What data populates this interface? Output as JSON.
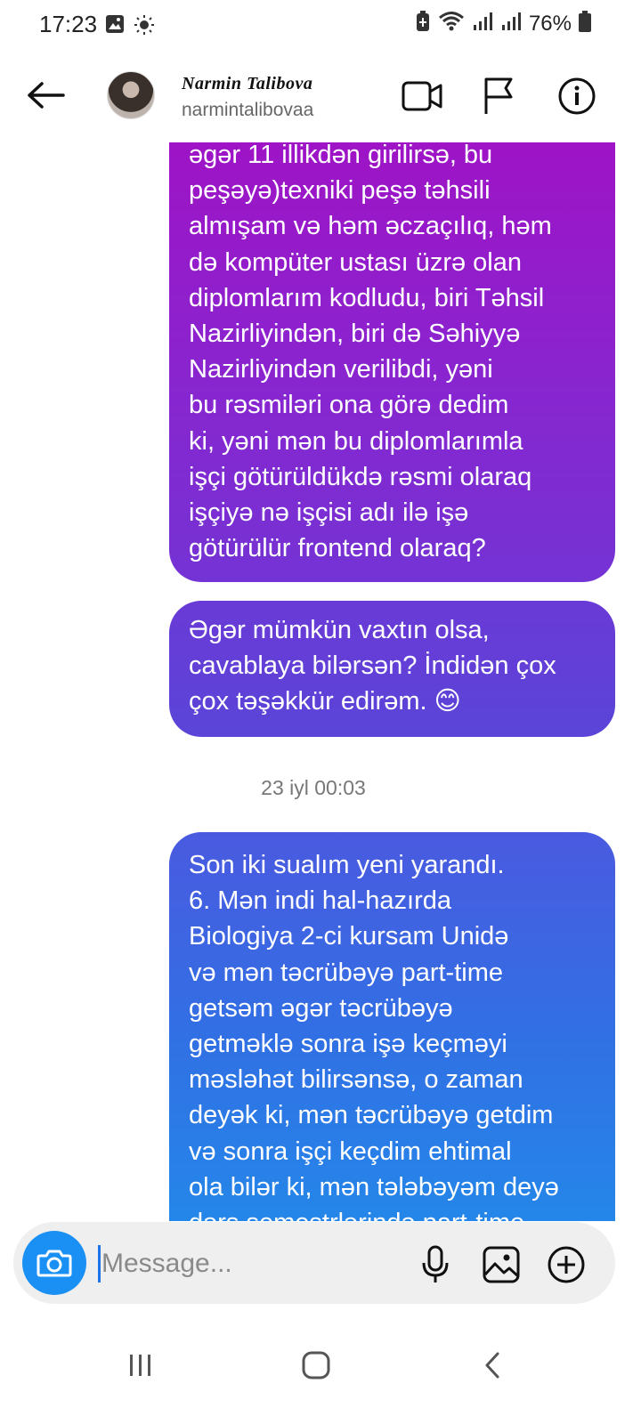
{
  "status_bar": {
    "time": "17:23",
    "battery": "76%",
    "icons": [
      "image-notification-icon",
      "brightness-icon",
      "battery-saver-icon",
      "wifi-icon",
      "signal-icon",
      "signal-icon",
      "battery-icon"
    ]
  },
  "header": {
    "contact_name": "Narmin Talibova",
    "username": "narmintalibovaa",
    "icons": [
      "back-arrow-icon",
      "video-call-icon",
      "flag-icon",
      "info-icon"
    ]
  },
  "messages": [
    {
      "type": "sent",
      "text": "əgər 11 illikdən girilirsə, bu\npeşəyə)texniki peşə təhsili\nalmışam və həm əczaçılıq, həm\ndə kompüter ustası üzrə olan\ndiplomlarım kodludu, biri Təhsil\nNazirliyindən, biri də Səhiyyə\nNazirliyindən verilibdi, yəni\nbu rəsmiləri ona görə dedim\nki, yəni mən bu diplomlarımla\nişçi götürüldükdə rəsmi olaraq\nişçiyə nə işçisi adı ilə işə\ngötürülür frontend olaraq?"
    },
    {
      "type": "sent",
      "text": "Əgər mümkün vaxtın olsa,\ncavablaya bilərsən? İndidən çox\nçox təşəkkür edirəm. 😊"
    },
    {
      "type": "timestamp",
      "text": "23 iyl 00:03"
    },
    {
      "type": "sent",
      "text": "Son iki sualım yeni yarandı.\n6. Mən indi hal-hazırda\nBiologiya 2-ci kursam Unidə\nvə mən təcrübəyə part-time\ngetsəm əgər təcrübəyə\ngetməklə sonra işə keçməyi\nməsləhət bilirsənsə, o zaman\ndeyək ki, mən təcrübəyə getdim\nvə sonra işçi keçdim ehtimal\nola bilər ki, mən tələbəyəm deyə\ndərs semestrlərində part-time"
    }
  ],
  "composer": {
    "placeholder": "Message...",
    "value": "",
    "icons": [
      "camera-icon",
      "microphone-icon",
      "gallery-icon",
      "add-icon"
    ]
  },
  "colors": {
    "camera_button": "#1a8ff4",
    "bubble_top": "#a111c4",
    "bubble_mid": "#5a45d8",
    "bubble_bottom": "#2389ea"
  },
  "nav_bar": {
    "icons": [
      "recent-apps-icon",
      "home-icon",
      "back-icon"
    ]
  }
}
